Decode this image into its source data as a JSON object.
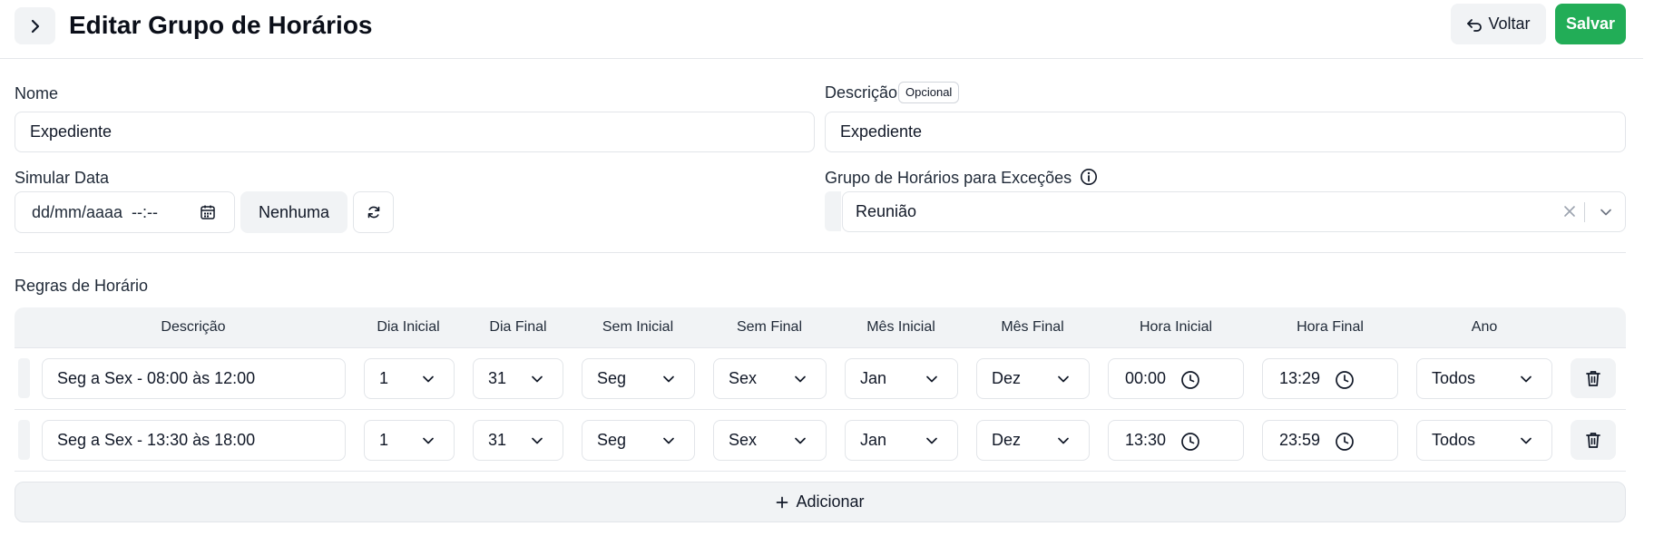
{
  "header": {
    "title": "Editar Grupo de Horários",
    "voltar_label": "Voltar",
    "salvar_label": "Salvar"
  },
  "form": {
    "nome_label": "Nome",
    "nome_value": "Expediente",
    "descricao_label": "Descrição",
    "descricao_badge": "Opcional",
    "descricao_value": "Expediente",
    "simular_label": "Simular Data",
    "simular_placeholder": "dd/mm/aaaa  --:--",
    "nenhuma_label": "Nenhuma",
    "excecoes_label": "Grupo de Horários para Exceções",
    "excecoes_value": "Reunião"
  },
  "rules": {
    "title": "Regras de Horário",
    "columns": [
      "Descrição",
      "Dia Inicial",
      "Dia Final",
      "Sem Inicial",
      "Sem Final",
      "Mês Inicial",
      "Mês Final",
      "Hora Inicial",
      "Hora Final",
      "Ano"
    ],
    "rows": [
      {
        "descricao": "Seg a Sex - 08:00 às 12:00",
        "dia_inicial": "1",
        "dia_final": "31",
        "sem_inicial": "Seg",
        "sem_final": "Sex",
        "mes_inicial": "Jan",
        "mes_final": "Dez",
        "hora_inicial": "00:00",
        "hora_final": "13:29",
        "ano": "Todos"
      },
      {
        "descricao": "Seg a Sex - 13:30 às 18:00",
        "dia_inicial": "1",
        "dia_final": "31",
        "sem_inicial": "Seg",
        "sem_final": "Sex",
        "mes_inicial": "Jan",
        "mes_final": "Dez",
        "hora_inicial": "13:30",
        "hora_final": "23:59",
        "ano": "Todos"
      }
    ],
    "add_label": "Adicionar"
  },
  "colors": {
    "primary_green": "#22ad57",
    "muted_bg": "#f1f3f5",
    "border": "#e2e5e9"
  }
}
